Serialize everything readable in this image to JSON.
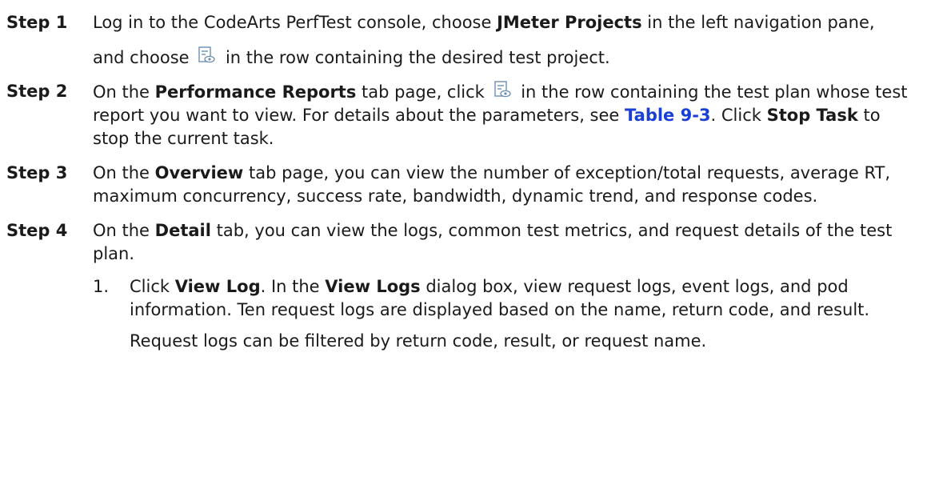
{
  "steps": [
    {
      "label": "Step 1",
      "t1": "Log in to the CodeArts PerfTest console, choose ",
      "b1": "JMeter Projects",
      "t2": " in the left navigation pane, and choose ",
      "t3": " in the row containing the desired test project.",
      "icon": "report-view-icon"
    },
    {
      "label": "Step 2",
      "t1": "On the ",
      "b1": "Performance Reports",
      "t2": " tab page, click ",
      "t3": " in the row containing the test plan whose test report you want to view. For details about the parameters, see ",
      "link": "Table 9-3",
      "t4": ". Click ",
      "b2": "Stop Task",
      "t5": " to stop the current task.",
      "icon": "report-view-icon"
    },
    {
      "label": "Step 3",
      "t1": "On the ",
      "b1": "Overview",
      "t2": " tab page, you can view the number of exception/total requests, average RT, maximum concurrency, success rate, bandwidth, dynamic trend, and response codes."
    },
    {
      "label": "Step 4",
      "t1": "On the ",
      "b1": "Detail",
      "t2": " tab, you can view the logs, common test metrics, and request details of the test plan.",
      "sub": {
        "num": "1.",
        "t1": "Click ",
        "b1": "View Log",
        "t2": ". In the ",
        "b2": "View Logs",
        "t3": " dialog box, view request logs, event logs, and pod information. Ten request logs are displayed based on the name, return code, and result.",
        "para": "Request logs can be filtered by return code, result, or request name."
      }
    }
  ],
  "colors": {
    "link": "#1a3fd6",
    "text": "#1a1a1a",
    "icon": "#6b8fb0"
  }
}
